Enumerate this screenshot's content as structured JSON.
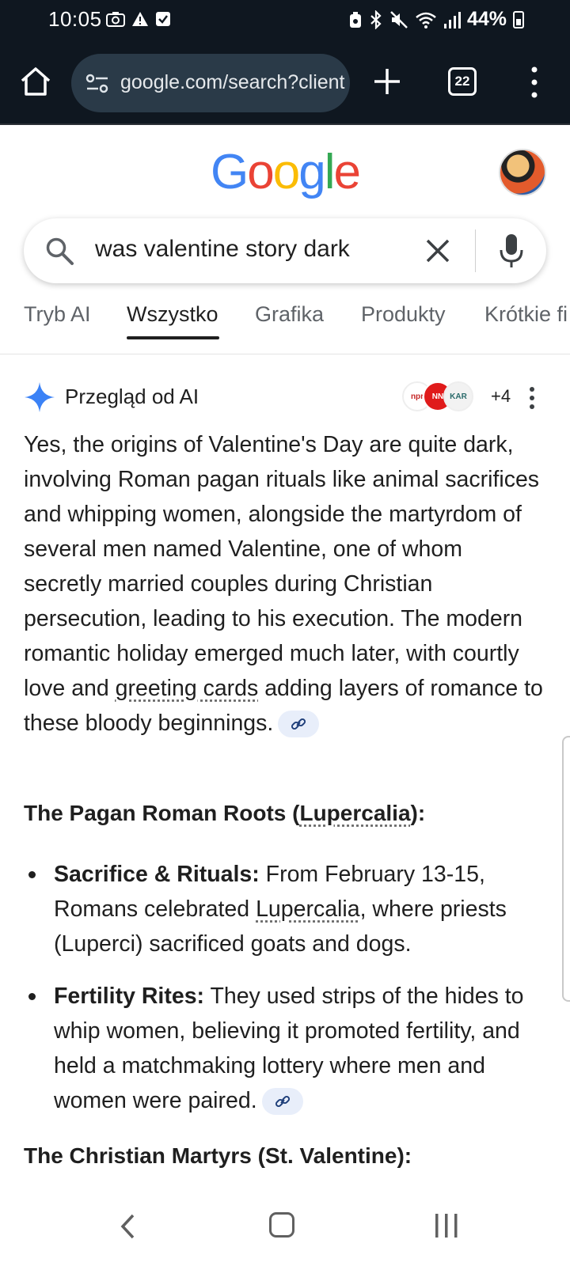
{
  "status_bar": {
    "time": "10:05",
    "battery_percent": "44%",
    "icons": [
      "screenshot-icon",
      "warning-icon",
      "check-box-icon",
      "lock-battery-icon",
      "bluetooth-icon",
      "mute-icon",
      "wifi-icon",
      "signal-icon",
      "battery-icon"
    ]
  },
  "browser": {
    "url": "google.com/search?client",
    "tab_count": "22"
  },
  "google": {
    "logo": "Google",
    "colors": {
      "blue": "#4285F4",
      "red": "#EA4335",
      "yellow": "#FBBC05",
      "green": "#34A853"
    }
  },
  "search": {
    "query": "was valentine story dark"
  },
  "tabs": [
    {
      "label": "Tryb AI",
      "active": false
    },
    {
      "label": "Wszystko",
      "active": true
    },
    {
      "label": "Grafika",
      "active": false
    },
    {
      "label": "Produkty",
      "active": false
    },
    {
      "label": "Krótkie fi",
      "active": false
    }
  ],
  "ai_overview": {
    "title": "Przegląd od AI",
    "sources_more": "+4",
    "source_badges": [
      "npr",
      "NN",
      "KAR"
    ],
    "paragraph": {
      "part1": "Yes, the origins of Valentine's Day are quite dark, involving Roman pagan rituals like animal sacrifices and whipping women, alongside the martyrdom of several men named Valentine, one of whom secretly married couples during Christian persecution, leading to his execution. The modern romantic holiday emerged much later, with courtly love and ",
      "link": "greeting cards",
      "part2": " adding layers of romance to these bloody beginnings."
    },
    "section1": {
      "heading_prefix": "The Pagan Roman Roots (",
      "heading_link": "Lupercalia",
      "heading_suffix": "):",
      "bullets": [
        {
          "label": "Sacrifice & Rituals:",
          "text_before": " From February 13-15, Romans celebrated ",
          "link": "Lupercalia",
          "text_after": ", where priests (Luperci) sacrificed goats and dogs."
        },
        {
          "label": "Fertility Rites:",
          "text": " They used strips of the hides to whip women, believing it promoted fertility, and held a matchmaking lottery where men and women were paired."
        }
      ]
    },
    "section2": {
      "heading": "The Christian Martyrs (St. Valentine):"
    }
  }
}
